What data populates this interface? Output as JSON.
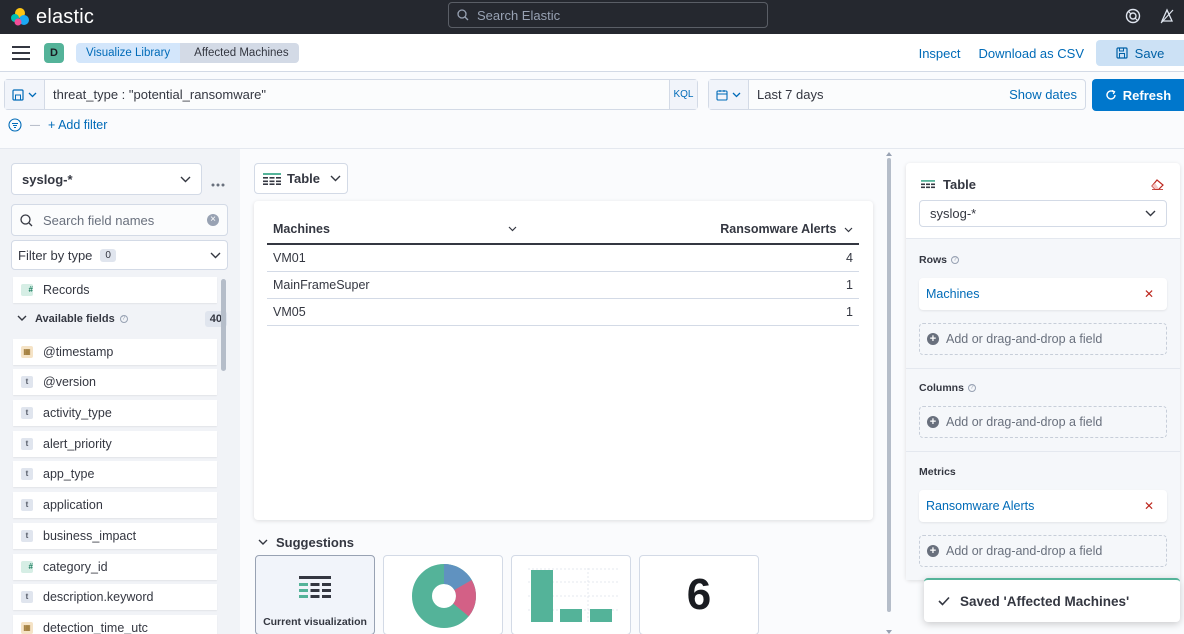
{
  "header": {
    "brand": "elastic",
    "search_placeholder": "Search Elastic"
  },
  "appbar": {
    "space_initial": "D",
    "breadcrumbs": [
      "Visualize Library",
      "Affected Machines"
    ],
    "inspect": "Inspect",
    "download": "Download as CSV",
    "save": "Save"
  },
  "query": {
    "text": "threat_type : \"potential_ransomware\"",
    "language": "KQL",
    "time_range": "Last 7 days",
    "show_dates": "Show dates",
    "refresh": "Refresh",
    "add_filter": "+ Add filter"
  },
  "sidebar": {
    "index_pattern": "syslog-*",
    "search_placeholder": "Search field names",
    "filter_by_type": "Filter by type",
    "filter_count": "0",
    "records": "Records",
    "available_label": "Available fields",
    "available_count": "40",
    "fields": [
      {
        "type": "date",
        "glyph": "▦",
        "name": "@timestamp"
      },
      {
        "type": "text",
        "glyph": "t",
        "name": "@version"
      },
      {
        "type": "text",
        "glyph": "t",
        "name": "activity_type"
      },
      {
        "type": "text",
        "glyph": "t",
        "name": "alert_priority"
      },
      {
        "type": "text",
        "glyph": "t",
        "name": "app_type"
      },
      {
        "type": "text",
        "glyph": "t",
        "name": "application"
      },
      {
        "type": "text",
        "glyph": "t",
        "name": "business_impact"
      },
      {
        "type": "number",
        "glyph": "#",
        "name": "category_id"
      },
      {
        "type": "text",
        "glyph": "t",
        "name": "description.keyword"
      },
      {
        "type": "date",
        "glyph": "▦",
        "name": "detection_time_utc"
      }
    ]
  },
  "workspace": {
    "chart_type": "Table",
    "table": {
      "columns": [
        "Machines",
        "Ransomware Alerts"
      ],
      "rows": [
        [
          "VM01",
          "4"
        ],
        [
          "MainFrameSuper",
          "1"
        ],
        [
          "VM05",
          "1"
        ]
      ]
    },
    "suggestions_title": "Suggestions",
    "suggestion_current": "Current visualization",
    "metric_value": "6"
  },
  "config": {
    "type": "Table",
    "index_pattern": "syslog-*",
    "rows_label": "Rows",
    "rows_field": "Machines",
    "columns_label": "Columns",
    "metrics_label": "Metrics",
    "metrics_field": "Ransomware Alerts",
    "add_field": "Add or drag-and-drop a field"
  },
  "toast": {
    "message": "Saved 'Affected Machines'"
  },
  "colors": {
    "accent": "#0077cc",
    "success": "#54b399",
    "donut": [
      "#6092c0",
      "#d36086",
      "#54b399"
    ]
  }
}
